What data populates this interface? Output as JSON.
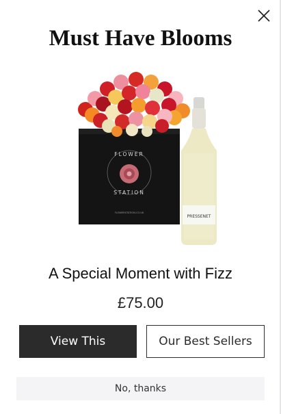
{
  "popup": {
    "title": "Must Have Blooms",
    "product": {
      "name": "A Special Moment with Fizz",
      "price": "£75.00",
      "image": {
        "box_brand_top": "FLOWER",
        "box_brand_bottom": "STATION",
        "box_website": "FLOWERSTATION.CO.UK",
        "bottle_label": "PRESSENET"
      }
    },
    "buttons": {
      "primary": "View This",
      "secondary": "Our Best Sellers",
      "dismiss": "No, thanks"
    },
    "icons": {
      "close": "close-icon"
    },
    "colors": {
      "primary_button_bg": "#2b2b2b",
      "dismiss_bg": "#f4f4f6"
    }
  }
}
